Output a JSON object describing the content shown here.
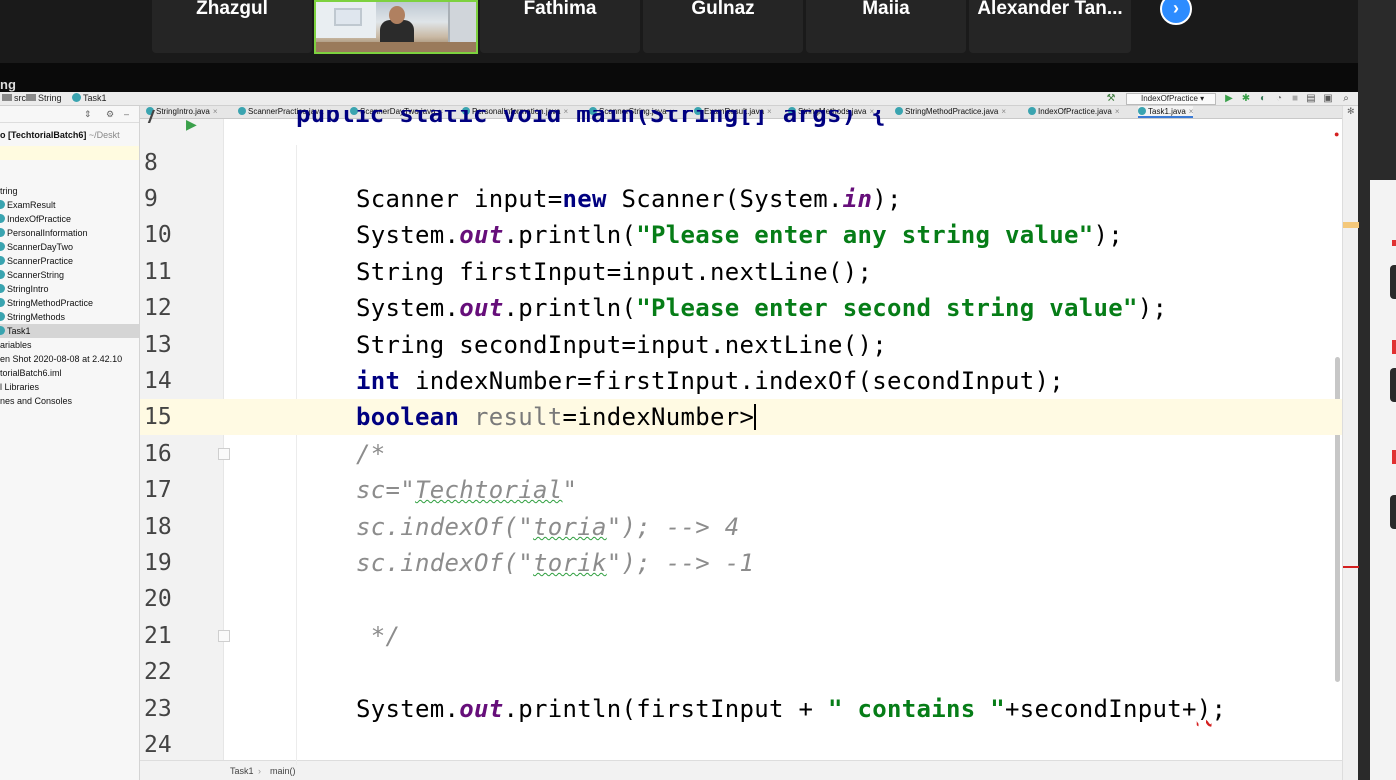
{
  "zoom": {
    "participants": [
      {
        "name": "Zhazgul"
      },
      {
        "name": "Fathima"
      },
      {
        "name": "Gulnaz"
      },
      {
        "name": "Maiia"
      },
      {
        "name": "Alexander Tan..."
      }
    ],
    "next_page_glyph": "›",
    "window_title_fragment": "ng"
  },
  "ide": {
    "breadcrumbs": [
      "src",
      "String",
      "Task1"
    ],
    "run_config": "IndexOfPractice",
    "tabs": [
      {
        "label": "StringIntro.java"
      },
      {
        "label": "ScannerPractice.java"
      },
      {
        "label": "ScannerDayTwo.java"
      },
      {
        "label": "PersonalInformation.java"
      },
      {
        "label": "ScannerString.java"
      },
      {
        "label": "ExamResult.java"
      },
      {
        "label": "StringMethods.java"
      },
      {
        "label": "StringMethodPractice.java"
      },
      {
        "label": "IndexOfPractice.java"
      },
      {
        "label": "Task1.java",
        "active": true
      }
    ],
    "project": {
      "root": "o [TechtorialBatch6]",
      "root_path": "~/Deskt",
      "package": "tring",
      "files": [
        "ExamResult",
        "IndexOfPractice",
        "PersonalInformation",
        "ScannerDayTwo",
        "ScannerPractice",
        "ScannerString",
        "StringIntro",
        "StringMethodPractice",
        "StringMethods",
        "Task1"
      ],
      "extra": [
        "ariables",
        "en Shot 2020-08-08 at 2.42.10",
        "torialBatch6.iml",
        "l Libraries",
        "nes and Consoles"
      ]
    },
    "code": {
      "first_line_number": "7",
      "first_line_text": "public static void main(String[] args) {",
      "line_numbers": [
        "8",
        "9",
        "10",
        "11",
        "12",
        "13",
        "14",
        "15",
        "16",
        "17",
        "18",
        "19",
        "20",
        "21",
        "22",
        "23",
        "24"
      ],
      "line9": {
        "a": "Scanner input=",
        "kw": "new",
        "b": " Scanner(System.",
        "fld": "in",
        "c": ");"
      },
      "line10": {
        "a": "System.",
        "fld": "out",
        "b": ".println(",
        "str": "\"Please enter any string value\"",
        "c": ");"
      },
      "line11": "String firstInput=input.nextLine();",
      "line12": {
        "a": "System.",
        "fld": "out",
        "b": ".println(",
        "str": "\"Please enter second string value\"",
        "c": ");"
      },
      "line13": "String secondInput=input.nextLine();",
      "line14": {
        "kw": "int",
        "a": " indexNumber=firstInput.indexOf(secondInput);"
      },
      "line15": {
        "kw": "boolean",
        "unused": "result",
        "a": "=indexNumber>"
      },
      "line16": "/*",
      "line17": {
        "a": "sc=\"",
        "sq": "Techtorial",
        "b": "\""
      },
      "line18": {
        "a": "sc.indexOf(\"",
        "sq": "toria",
        "b": "\"); --> 4"
      },
      "line19": {
        "a": "sc.indexOf(\"",
        "sq": "torik",
        "b": "\"); --> -1"
      },
      "line21": " */",
      "line23": {
        "a": "System.",
        "fld": "out",
        "b": ".println(firstInput + ",
        "str": "\" contains \"",
        "c": "+secondInput+",
        "err": ")",
        "d": ";"
      }
    },
    "status": {
      "class": "Task1",
      "method": "main()"
    }
  }
}
